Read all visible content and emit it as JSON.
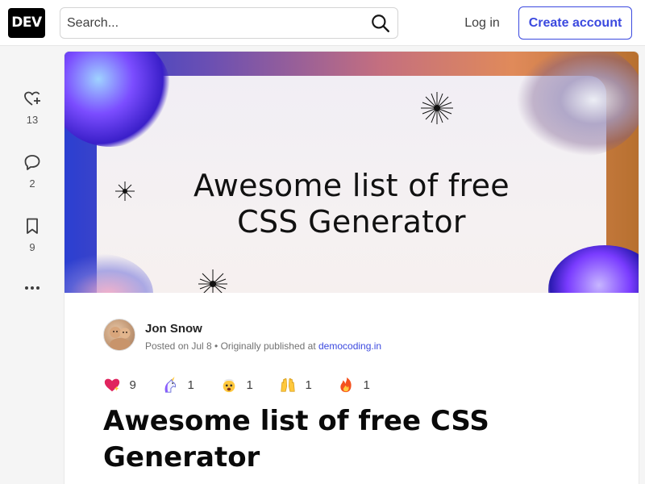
{
  "header": {
    "logo_text": "DEV",
    "search_placeholder": "Search...",
    "login_label": "Log in",
    "create_account_label": "Create account",
    "accent_color": "#3b49df"
  },
  "rail": {
    "reactions_count": "13",
    "comments_count": "2",
    "bookmarks_count": "9",
    "icons": [
      "heart-plus-icon",
      "comment-icon",
      "bookmark-icon",
      "more-horizontal-icon"
    ]
  },
  "cover": {
    "title_line1": "Awesome list of free",
    "title_line2": "CSS Generator"
  },
  "author": {
    "name": "Jon Snow",
    "posted_prefix": "Posted on Jul 8 • Originally published at ",
    "source_link": "democoding.in"
  },
  "reactions": [
    {
      "icon": "sparkle-heart-icon",
      "count": "9"
    },
    {
      "icon": "unicorn-icon",
      "count": "1"
    },
    {
      "icon": "exploding-head-icon",
      "count": "1"
    },
    {
      "icon": "raised-hands-icon",
      "count": "1"
    },
    {
      "icon": "fire-icon",
      "count": "1"
    }
  ],
  "article": {
    "title_line1": "Awesome list of free CSS",
    "title_line2": "Generator"
  }
}
